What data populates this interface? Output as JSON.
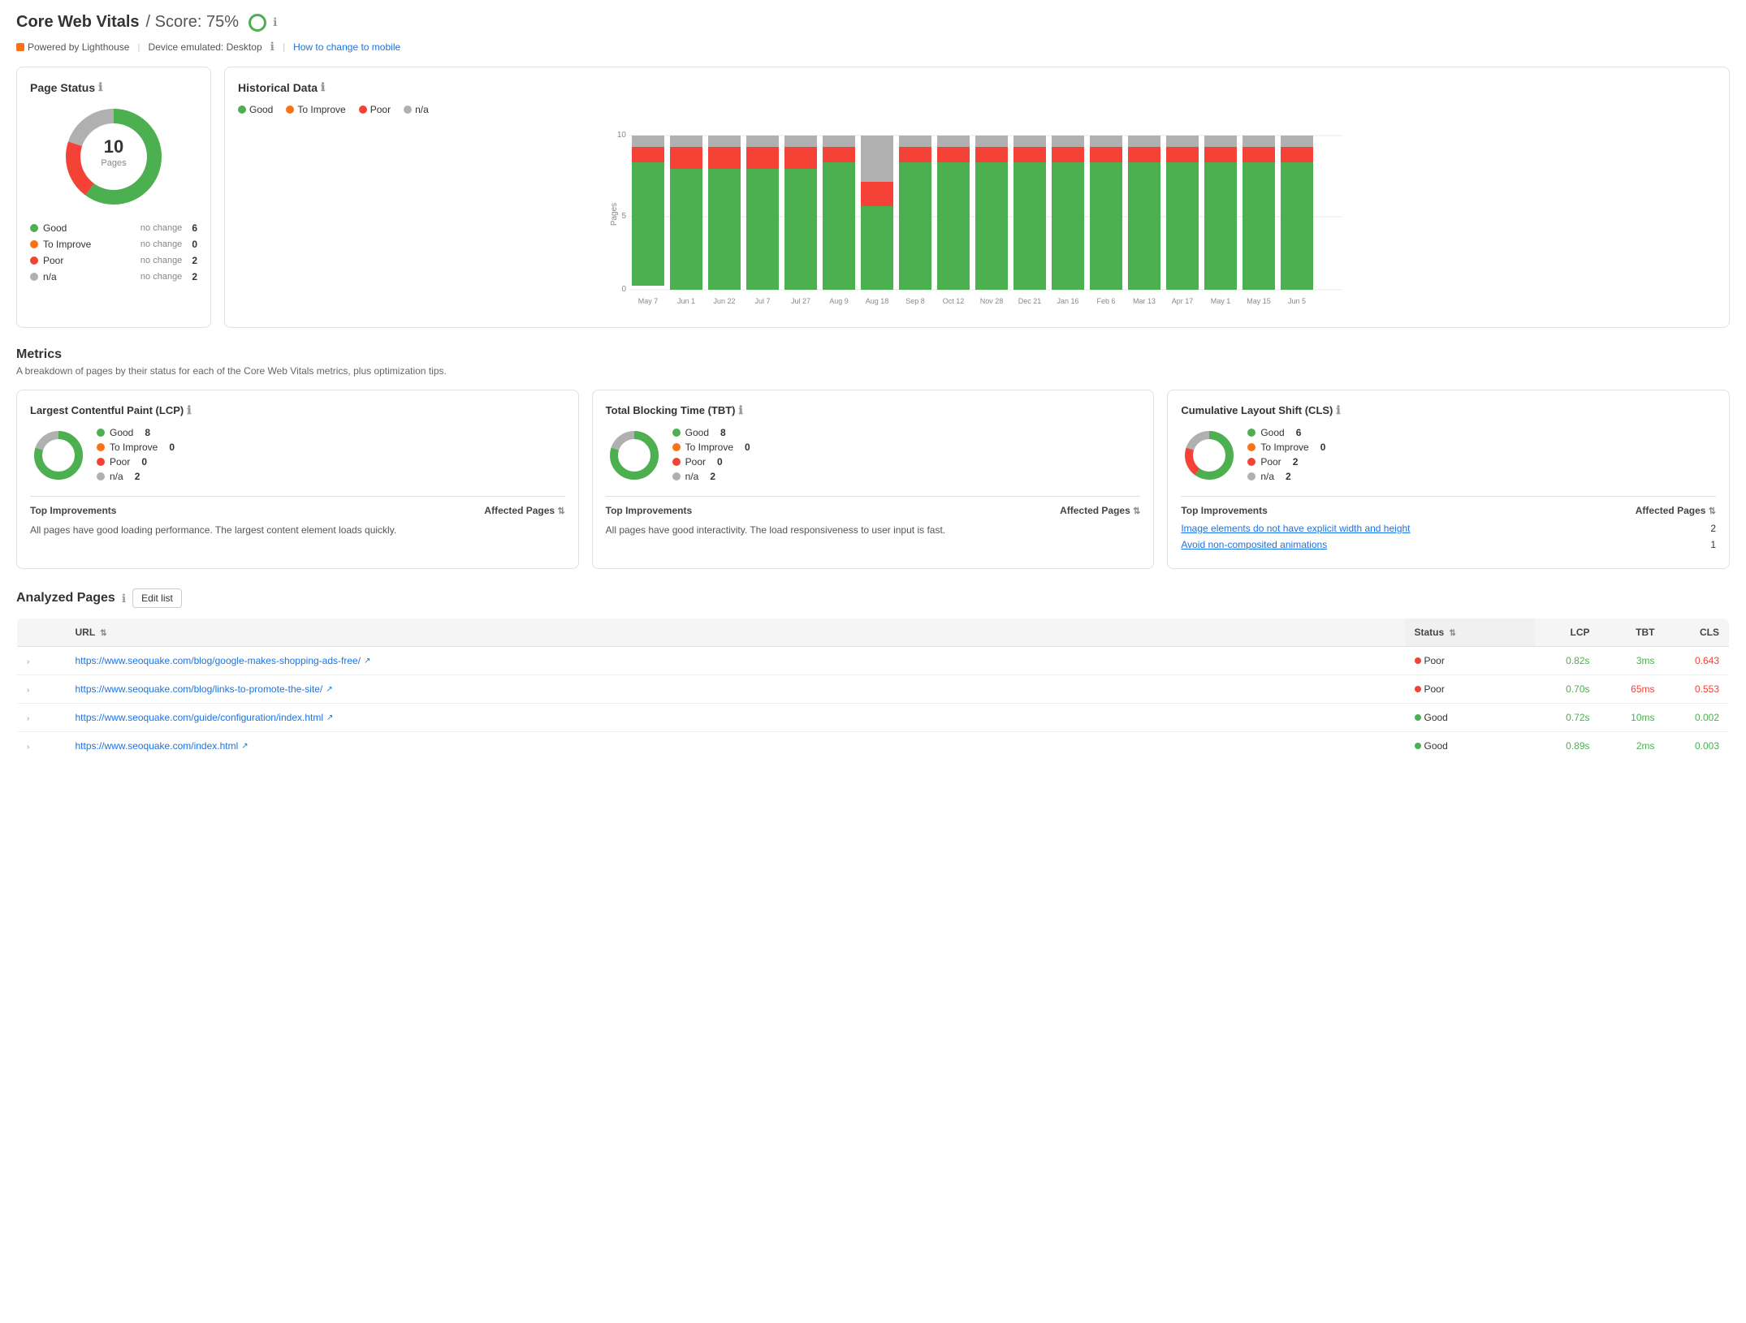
{
  "header": {
    "title": "Core Web Vitals",
    "score_label": "/ Score: 75%",
    "info_icon": "ℹ",
    "lighthouse_label": "Powered by Lighthouse",
    "device_label": "Device emulated: Desktop",
    "mobile_link": "How to change to mobile"
  },
  "page_status": {
    "title": "Page Status",
    "center_count": "10",
    "center_label": "Pages",
    "legend": [
      {
        "color": "#4CAF50",
        "label": "Good",
        "change": "no change",
        "count": "6"
      },
      {
        "color": "#F97316",
        "label": "To Improve",
        "change": "no change",
        "count": "0"
      },
      {
        "color": "#F44336",
        "label": "Poor",
        "change": "no change",
        "count": "2"
      },
      {
        "color": "#B0B0B0",
        "label": "n/a",
        "change": "no change",
        "count": "2"
      }
    ]
  },
  "historical_data": {
    "title": "Historical Data",
    "legend": [
      {
        "color": "#4CAF50",
        "label": "Good"
      },
      {
        "color": "#F97316",
        "label": "To Improve"
      },
      {
        "color": "#F44336",
        "label": "Poor"
      },
      {
        "color": "#B0B0B0",
        "label": "n/a"
      }
    ],
    "y_labels": [
      "0",
      "5",
      "10"
    ],
    "x_labels": [
      "May 7",
      "Jun 1",
      "Jun 22",
      "Jul 7",
      "Jul 27",
      "Aug 9",
      "Aug 18",
      "Sep 8",
      "Oct 12",
      "Nov 28",
      "Dec 21",
      "Jan 16",
      "Feb 6",
      "Mar 13",
      "Apr 17",
      "May 1",
      "May 15",
      "Jun 5"
    ],
    "y_axis_label": "Pages"
  },
  "metrics": {
    "title": "Metrics",
    "subtitle": "A breakdown of pages by their status for each of the Core Web Vitals metrics, plus optimization tips.",
    "items": [
      {
        "name": "Largest Contentful Paint (LCP)",
        "legend": [
          {
            "color": "#4CAF50",
            "label": "Good",
            "count": "8"
          },
          {
            "color": "#F97316",
            "label": "To Improve",
            "count": "0"
          },
          {
            "color": "#F44336",
            "label": "Poor",
            "count": "0"
          },
          {
            "color": "#B0B0B0",
            "label": "n/a",
            "count": "2"
          }
        ],
        "top_improvements_label": "Top Improvements",
        "affected_pages_label": "Affected Pages",
        "improvements": [
          {
            "text": "All pages have good loading performance. The largest content element loads quickly.",
            "count": null,
            "is_text": true
          }
        ]
      },
      {
        "name": "Total Blocking Time (TBT)",
        "legend": [
          {
            "color": "#4CAF50",
            "label": "Good",
            "count": "8"
          },
          {
            "color": "#F97316",
            "label": "To Improve",
            "count": "0"
          },
          {
            "color": "#F44336",
            "label": "Poor",
            "count": "0"
          },
          {
            "color": "#B0B0B0",
            "label": "n/a",
            "count": "2"
          }
        ],
        "top_improvements_label": "Top Improvements",
        "affected_pages_label": "Affected Pages",
        "improvements": [
          {
            "text": "All pages have good interactivity. The load responsiveness to user input is fast.",
            "count": null,
            "is_text": true
          }
        ]
      },
      {
        "name": "Cumulative Layout Shift (CLS)",
        "legend": [
          {
            "color": "#4CAF50",
            "label": "Good",
            "count": "6"
          },
          {
            "color": "#F97316",
            "label": "To Improve",
            "count": "0"
          },
          {
            "color": "#F44336",
            "label": "Poor",
            "count": "2"
          },
          {
            "color": "#B0B0B0",
            "label": "n/a",
            "count": "2"
          }
        ],
        "top_improvements_label": "Top Improvements",
        "affected_pages_label": "Affected Pages",
        "improvements": [
          {
            "text": "Image elements do not have explicit width and height",
            "count": "2",
            "is_text": false
          },
          {
            "text": "Avoid non-composited animations",
            "count": "1",
            "is_text": false
          }
        ]
      }
    ]
  },
  "analyzed_pages": {
    "title": "Analyzed Pages",
    "edit_btn_label": "Edit list",
    "columns": [
      "URL",
      "Status",
      "LCP",
      "TBT",
      "CLS"
    ],
    "rows": [
      {
        "url": "https://www.seoquake.com/blog/google-makes-shopping-ads-free/",
        "status": "Poor",
        "status_color": "#F44336",
        "lcp": "0.82s",
        "lcp_color": "#4CAF50",
        "tbt": "3ms",
        "tbt_color": "#4CAF50",
        "cls": "0.643",
        "cls_color": "#F44336"
      },
      {
        "url": "https://www.seoquake.com/blog/links-to-promote-the-site/",
        "status": "Poor",
        "status_color": "#F44336",
        "lcp": "0.70s",
        "lcp_color": "#4CAF50",
        "tbt": "65ms",
        "tbt_color": "#F44336",
        "cls": "0.553",
        "cls_color": "#F44336"
      },
      {
        "url": "https://www.seoquake.com/guide/configuration/index.html",
        "status": "Good",
        "status_color": "#4CAF50",
        "lcp": "0.72s",
        "lcp_color": "#4CAF50",
        "tbt": "10ms",
        "tbt_color": "#4CAF50",
        "cls": "0.002",
        "cls_color": "#4CAF50"
      },
      {
        "url": "https://www.seoquake.com/index.html",
        "status": "Good",
        "status_color": "#4CAF50",
        "lcp": "0.89s",
        "lcp_color": "#4CAF50",
        "tbt": "2ms",
        "tbt_color": "#4CAF50",
        "cls": "0.003",
        "cls_color": "#4CAF50"
      }
    ]
  }
}
